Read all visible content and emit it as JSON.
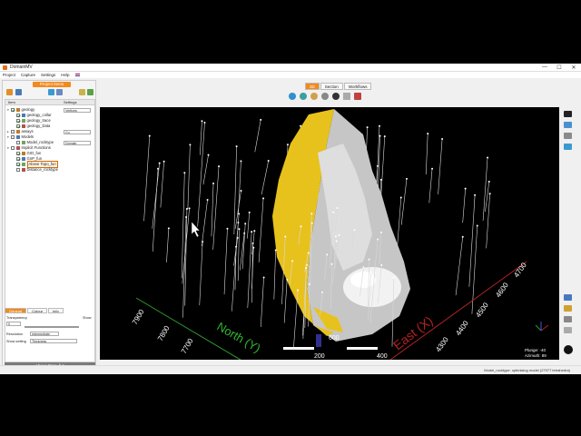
{
  "window": {
    "title": "DomainMV",
    "buttons": [
      "—",
      "☐",
      "✕"
    ]
  },
  "menu": [
    "Project",
    "Capture",
    "Settings",
    "Help"
  ],
  "left_panel": {
    "header": "Project Items",
    "tree_columns": [
      "Item",
      "Settings"
    ],
    "tree": [
      {
        "label": "geology",
        "level": 0,
        "checked": true,
        "expanded": true,
        "setting": "Vertices"
      },
      {
        "label": "geology_collar",
        "level": 1,
        "checked": true
      },
      {
        "label": "geology_trace",
        "level": 1,
        "checked": true
      },
      {
        "label": "geology_Data",
        "level": 1,
        "checked": true
      },
      {
        "label": "assays",
        "level": 0,
        "checked": false,
        "expanded": false,
        "setting": "Cu"
      },
      {
        "label": "Models",
        "level": 0,
        "checked": false,
        "expanded": true
      },
      {
        "label": "Model_rocktype",
        "level": 1,
        "checked": false,
        "setting": "Domain"
      },
      {
        "label": "Implicit Functions",
        "level": 0,
        "checked": false,
        "expanded": true
      },
      {
        "label": "GrD_fun",
        "level": 1,
        "checked": true
      },
      {
        "label": "GnP_fun",
        "level": 1,
        "checked": true
      },
      {
        "label": "Above Topo_fun",
        "level": 1,
        "checked": true,
        "selected": true
      },
      {
        "label": "Distance_rocktype",
        "level": 1,
        "checked": false
      }
    ],
    "props": {
      "tabs": [
        "General",
        "Colour",
        "Info"
      ],
      "transparency_label": "Transparency",
      "transparency_value": "0",
      "show_label": "Show",
      "resolution_label": "Resolution",
      "resolution_value": "Intermediate",
      "show_setting_label": "Show setting",
      "show_setting_value": "Thickness"
    },
    "bottom_button": "Above Topo_fun"
  },
  "view_tabs": [
    "3D",
    "Section",
    "Workflows"
  ],
  "active_view_tab": "3D",
  "viewport": {
    "axis_north_label": "North (Y)",
    "axis_east_label": "East (X)",
    "north_ticks": [
      "7900",
      "7800",
      "7700"
    ],
    "east_ticks": [
      "4700",
      "4600",
      "4500",
      "4400",
      "4300"
    ],
    "bottom_ticks": [
      "200",
      "400",
      "600"
    ],
    "plunge_text": "Plunge: -40",
    "azimuth_text": "Azimuth: 89",
    "surface_colors": {
      "yellow": "#e8c21c",
      "grey": "#c8c8c8",
      "white": "#f2f2f2"
    },
    "north_axis_color": "#2e9a2e",
    "east_axis_color": "#b22222"
  },
  "status": {
    "message": "Model_rocktype: optimising model (27977 tetrahedra)"
  }
}
